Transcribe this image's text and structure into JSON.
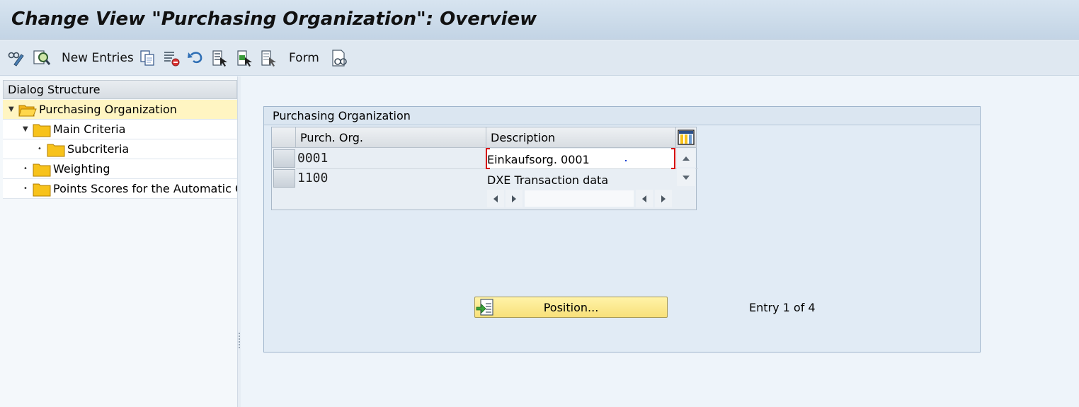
{
  "window": {
    "title": "Change View \"Purchasing Organization\": Overview"
  },
  "toolbar": {
    "new_entries_label": "New Entries",
    "form_label": "Form",
    "icons": [
      "display-change-icon",
      "find-icon",
      "copy-icon",
      "delete-icon",
      "undo-icon",
      "select-all-icon",
      "select-block-icon",
      "deselect-all-icon",
      "print-icon"
    ]
  },
  "dialog_structure": {
    "header": "Dialog Structure",
    "items": [
      {
        "label": "Purchasing Organization",
        "level": 0,
        "expanded": true,
        "selected": true
      },
      {
        "label": "Main Criteria",
        "level": 1,
        "expanded": true
      },
      {
        "label": "Subcriteria",
        "level": 2
      },
      {
        "label": "Weighting",
        "level": 1
      },
      {
        "label": "Points Scores for the Automatic Criteria",
        "level": 1
      }
    ]
  },
  "group": {
    "title": "Purchasing Organization",
    "table": {
      "columns": [
        "Purch. Org.",
        "Description"
      ],
      "rows": [
        {
          "org": "0001",
          "desc": "Einkaufsorg. 0001"
        },
        {
          "org": "1100",
          "desc": "DXE Transaction data"
        }
      ]
    },
    "position_button_label": "Position...",
    "entry_status": "Entry 1 of 4"
  },
  "colors": {
    "title_bg": "#c9d9e9",
    "selected_node": "#fff5c2",
    "button_yellow": "#f8e07a",
    "folder": "#f7c21b",
    "focus_marker": "#d40000"
  }
}
